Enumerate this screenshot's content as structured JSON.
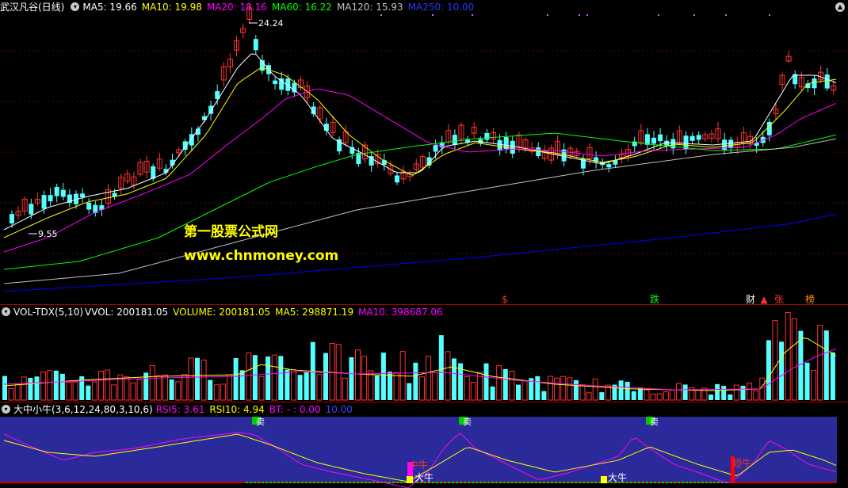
{
  "price_panel": {
    "stock_name": "武汉凡谷(日线)",
    "ma5": "MA5: 19.66",
    "ma10": "MA10: 19.98",
    "ma20": "MA20: 18.16",
    "ma60": "MA60: 16.22",
    "ma120": "MA120: 15.93",
    "ma250": "MA250: 10.00",
    "high_label": "24.24",
    "low_label": "9.55",
    "event_markers": [
      "$",
      "跌",
      "财",
      "▲",
      "张",
      "榜"
    ],
    "colors": {
      "ma5": "#ffffff",
      "ma10": "#ffff00",
      "ma20": "#ff00ff",
      "ma60": "#00ff00",
      "ma120": "#c0c0c0",
      "ma250": "#0000ff",
      "up": "#ff3232",
      "down": "#54ffff"
    }
  },
  "watermark": {
    "line1": "第一股票公式网",
    "line2": "www.chnmoney.com"
  },
  "volume_panel": {
    "name": "VOL-TDX(5,10)",
    "vvol": "VVOL: 200181.05",
    "volume": "VOLUME: 200181.05",
    "ma5": "MA5: 298871.19",
    "ma10": "MA10: 398687.06"
  },
  "indicator_panel": {
    "name": "大中小牛(3,6,12,24,80,3,10,6)",
    "rsi5": "RSI5: 3.61",
    "rsi10": "RSI10: 4.94",
    "bt": "BT: - : 0.00",
    "val": "10.00",
    "signals": [
      "卖",
      "卖",
      "卖",
      "中牛",
      "大牛",
      "大牛",
      "短牛"
    ]
  }
}
